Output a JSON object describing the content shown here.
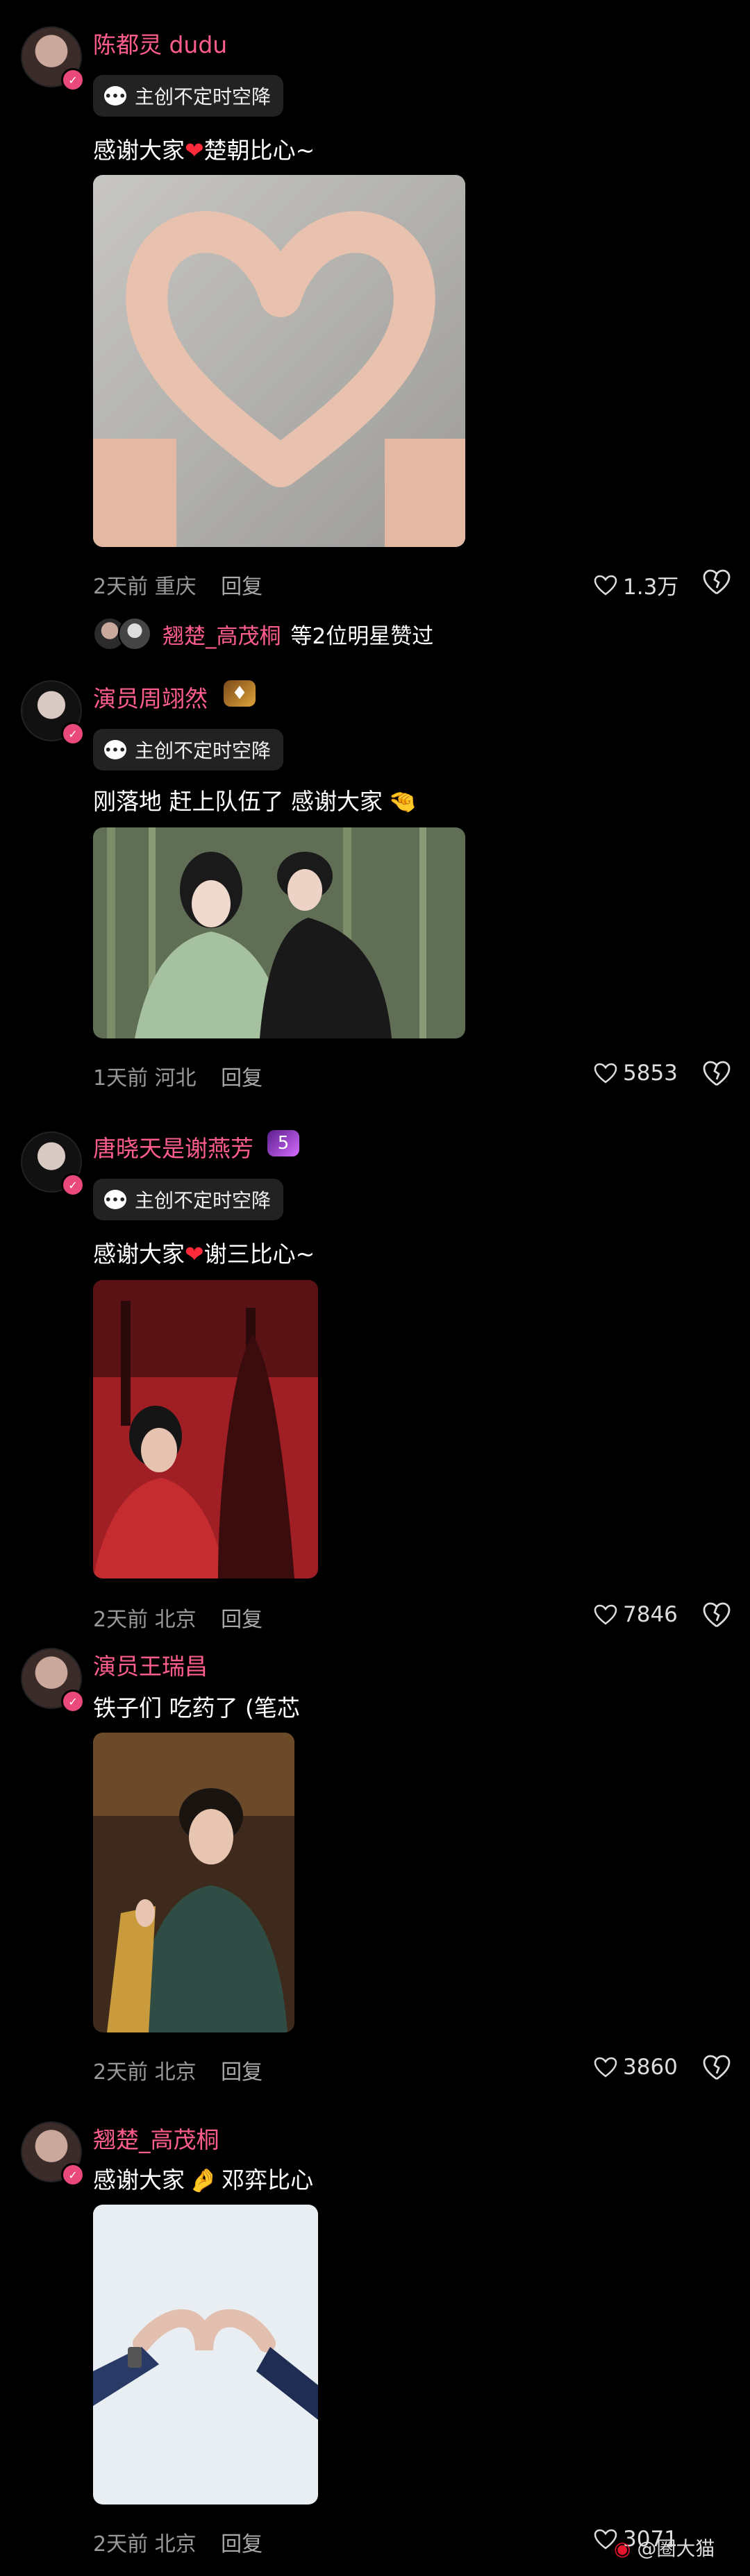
{
  "comments": [
    {
      "username": "陈都灵 dudu",
      "tag": "主创不定时空降",
      "text_a": "感谢大家",
      "text_b": "楚朝比心~",
      "location": "2天前 重庆",
      "reply": "回复",
      "likes": "1.3万"
    },
    {
      "username": "演员周翊然",
      "tag": "主创不定时空降",
      "text": "刚落地 赶上队伍了 感谢大家",
      "location": "1天前 河北",
      "reply": "回复",
      "likes": "5853"
    },
    {
      "username": "唐晓天是谢燕芳",
      "badge": "5",
      "tag": "主创不定时空降",
      "text_a": "感谢大家",
      "text_b": "谢三比心~",
      "location": "2天前 北京",
      "reply": "回复",
      "likes": "7846"
    },
    {
      "username": "演员王瑞昌",
      "text": "铁子们 吃药了 (笔芯",
      "location": "2天前 北京",
      "reply": "回复",
      "likes": "3860"
    },
    {
      "username": "翘楚_高茂桐",
      "text_a": "感谢大家",
      "text_b": "邓弈比心",
      "location": "2天前 北京",
      "reply": "回复",
      "likes": "3071"
    }
  ],
  "liked_by": {
    "name": "翘楚_高茂桐",
    "suffix": "等2位明星赞过"
  },
  "watermark": "@圈大猫",
  "colors": {
    "username": "#ff5d8c",
    "background": "#000000",
    "heart": "#ff2b3a"
  }
}
